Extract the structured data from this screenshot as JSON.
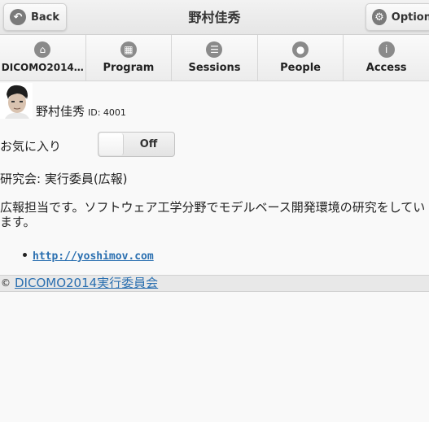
{
  "header": {
    "title": "野村佳秀",
    "back_label": "Back",
    "back_icon": "back-arrow-icon",
    "option_label": "Option",
    "option_icon": "gear-icon"
  },
  "nav": {
    "items": [
      {
        "label": "DICOMO2014…",
        "icon": "home-icon"
      },
      {
        "label": "Program",
        "icon": "calendar-grid-icon"
      },
      {
        "label": "Sessions",
        "icon": "list-icon"
      },
      {
        "label": "People",
        "icon": "person-icon"
      },
      {
        "label": "Access",
        "icon": "info-icon"
      }
    ]
  },
  "profile": {
    "name": "野村佳秀",
    "id_text": "ID: 4001",
    "favorite_label": "お気に入り",
    "favorite_toggle": "Off",
    "organization": "研究会: 実行委員(広報)",
    "bio": "広報担当です。ソフトウェア工学分野でモデルベース開発環境の研究をしています。",
    "links": [
      "http://yoshimov.com"
    ]
  },
  "footer": {
    "copyright_symbol": "©",
    "link_text": "DICOMO2014実行委員会"
  }
}
